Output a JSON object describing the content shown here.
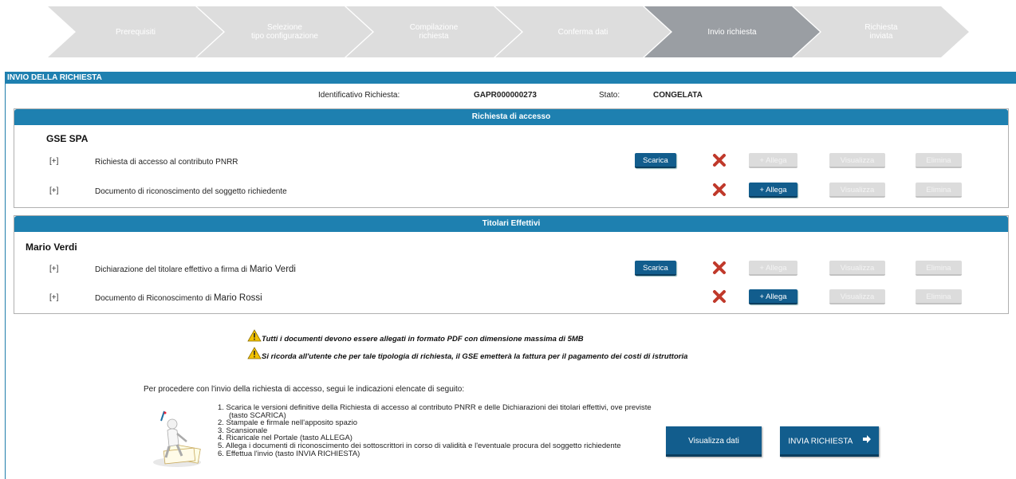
{
  "wizard": {
    "steps": [
      {
        "label": "Prerequisiti",
        "active": false
      },
      {
        "label": "Selezione\ntipo configurazione",
        "active": false
      },
      {
        "label": "Compilazione\nrichiesta",
        "active": false
      },
      {
        "label": "Conferma dati",
        "active": false
      },
      {
        "label": "Invio richiesta",
        "active": true
      },
      {
        "label": "Richiesta\ninviata",
        "active": false
      }
    ],
    "colors": {
      "inactive": "#dddddd",
      "active": "#9a9ea3"
    }
  },
  "page": {
    "section_title": "INVIO DELLA RICHIESTA",
    "id_label": "Identificativo Richiesta:",
    "id_value": "GAPR000000273",
    "status_label": "Stato:",
    "status_value": "CONGELATA"
  },
  "access_panel": {
    "title": "Richiesta di accesso",
    "owner": "GSE SPA",
    "rows": [
      {
        "expand": "[+]",
        "name": "Richiesta di accesso al contributo PNRR",
        "name_suffix": "",
        "download": "Scarica",
        "attach": "+ Allega",
        "view": "Visualizza",
        "delete": "Elimina"
      },
      {
        "expand": "[+]",
        "name": "Documento di riconoscimento del soggetto richiedente",
        "name_suffix": "",
        "attach": "+ Allega",
        "view": "Visualizza",
        "delete": "Elimina"
      }
    ]
  },
  "owners_panel": {
    "title": "Titolari Effettivi",
    "owner": "Mario Verdi",
    "rows": [
      {
        "expand": "[+]",
        "name": "Dichiarazione del titolare effettivo a firma di ",
        "name_suffix": "Mario Verdi",
        "download": "Scarica",
        "attach": "+ Allega",
        "view": "Visualizza",
        "delete": "Elimina"
      },
      {
        "expand": "[+]",
        "name": "Documento di Riconoscimento di ",
        "name_suffix": "Mario Rossi",
        "attach": "+ Allega",
        "view": "Visualizza",
        "delete": "Elimina"
      }
    ]
  },
  "warnings": [
    "Tutti i documenti devono essere allegati in formato PDF con dimensione massima di 5MB",
    "Si ricorda all'utente che per tale tipologia di richiesta, il GSE emetterà la fattura per il pagamento dei costi di istruttoria"
  ],
  "instructions": {
    "intro": "Per procedere con l'invio della richiesta di accesso, segui le indicazioni elencate di seguito:",
    "steps": [
      "1. Scarica le versioni definitive della Richiesta di accesso al contributo PNRR e delle Dichiarazioni dei titolari effettivi, ove previste (tasto SCARICA)",
      "2. Stampale e firmale nell'apposito spazio",
      "3. Scansionale",
      "4. Ricaricale nel Portale (tasto ALLEGA)",
      "5. Allega i documenti di riconoscimento dei sottoscrittori in corso di validità e l'eventuale procura del soggetto richiedente",
      "6. Effettua l'invio (tasto INVIA RICHIESTA)"
    ]
  },
  "actions": {
    "view_data": "Visualizza dati",
    "submit": "INVIA RICHIESTA"
  },
  "colors": {
    "header_blue": "#1e80b0",
    "button_blue": "#125d8d",
    "delete_red": "#c0392b",
    "warning_yellow": "#f2c200"
  }
}
